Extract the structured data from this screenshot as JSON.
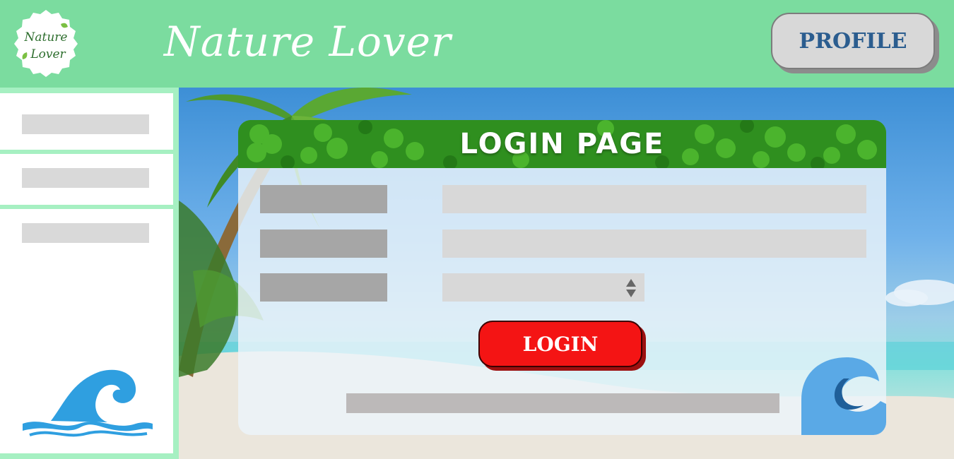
{
  "header": {
    "logo_text_line1": "Nature",
    "logo_text_line2": "Lover",
    "title": "Nature Lover",
    "profile_label": "PROFILE"
  },
  "sidebar": {
    "items": [
      {
        "label": ""
      },
      {
        "label": ""
      },
      {
        "label": ""
      }
    ],
    "wave_icon": "ocean-wave-icon"
  },
  "login": {
    "title": "LOGIN PAGE",
    "fields": [
      {
        "label": "",
        "value": ""
      },
      {
        "label": "",
        "value": ""
      },
      {
        "label": "",
        "value": ""
      }
    ],
    "select_icon": "select-arrows-icon",
    "login_label": "LOGIN",
    "footer_text": "",
    "corner_icon": "wave-icon"
  },
  "colors": {
    "header_bg": "#7bdc9f",
    "sidebar_bg": "#a6f0c2",
    "profile_text": "#2b5d8f",
    "login_button": "#f41414"
  }
}
